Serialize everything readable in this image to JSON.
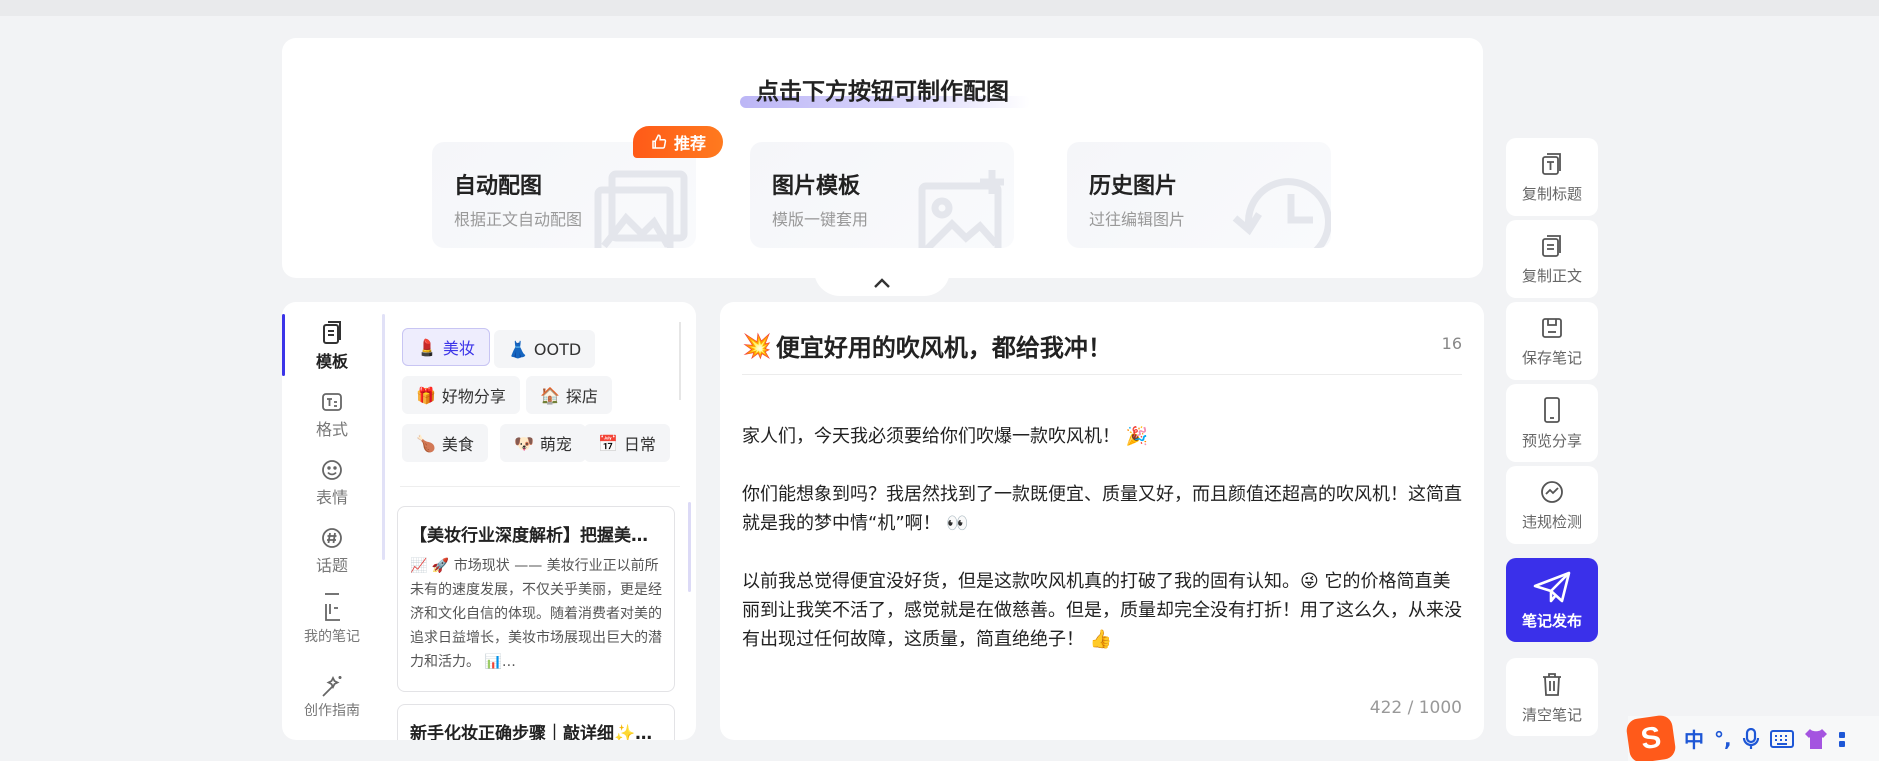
{
  "top_panel": {
    "title": "点击下方按钮可制作配图",
    "badge": "推荐",
    "cards": [
      {
        "name": "自动配图",
        "desc": "根据正文自动配图"
      },
      {
        "name": "图片模板",
        "desc": "模版一键套用"
      },
      {
        "name": "历史图片",
        "desc": "过往编辑图片"
      }
    ]
  },
  "side_nav": [
    {
      "label": "模板",
      "icon": "template-icon",
      "active": true
    },
    {
      "label": "格式",
      "icon": "format-icon"
    },
    {
      "label": "表情",
      "icon": "emoji-icon"
    },
    {
      "label": "话题",
      "icon": "hashtag-icon"
    },
    {
      "label": "我的笔记",
      "icon": "my-notes-icon"
    },
    {
      "label": "创作指南",
      "icon": "creation-guide-icon"
    }
  ],
  "categories": [
    {
      "emoji": "💄",
      "label": "美妆",
      "active": true
    },
    {
      "emoji": "👗",
      "label": "OOTD"
    },
    {
      "emoji": "🎁",
      "label": "好物分享"
    },
    {
      "emoji": "🏠",
      "label": "探店"
    },
    {
      "emoji": "🍗",
      "label": "美食"
    },
    {
      "emoji": "🐶",
      "label": "萌宠"
    },
    {
      "emoji": "📅",
      "label": "日常"
    }
  ],
  "template_cards": [
    {
      "title": "【美妆行业深度解析】把握美…",
      "body": "📈 🚀 市场现状 —— 美妆行业正以前所未有的速度发展，不仅关乎美丽，更是经济和文化自信的体现。随着消费者对美的追求日益增长，美妆市场展现出巨大的潜力和活力。 📊…"
    },
    {
      "title": "新手化妆正确步骤｜敲详细✨…",
      "body": ""
    }
  ],
  "editor": {
    "title_emoji": "💥",
    "title": "便宜好用的吹风机，都给我冲！",
    "title_count": "16",
    "paragraphs": [
      "家人们，今天我必须要给你们吹爆一款吹风机！ 🎉",
      "你们能想象到吗？我居然找到了一款既便宜、质量又好，而且颜值还超高的吹风机！这简直就是我的梦中情“机”啊！ 👀",
      "以前我总觉得便宜没好货，但是这款吹风机真的打破了我的固有认知。😜 它的价格简直美丽到让我笑不活了，感觉就是在做慈善。但是，质量却完全没有打折！用了这么久，从来没有出现过任何故障，这质量，简直绝绝子！ 👍"
    ],
    "char_count": "422 / 1000"
  },
  "toolbar": [
    {
      "label": "复制标题",
      "icon": "copy-title-icon"
    },
    {
      "label": "复制正文",
      "icon": "copy-body-icon"
    },
    {
      "label": "保存笔记",
      "icon": "save-icon"
    },
    {
      "label": "预览分享",
      "icon": "phone-preview-icon"
    },
    {
      "label": "违规检测",
      "icon": "violation-check-icon"
    },
    {
      "label": "笔记发布",
      "icon": "send-icon",
      "primary": true
    },
    {
      "label": "清空笔记",
      "icon": "trash-icon"
    }
  ],
  "ime": {
    "logo": "S",
    "lang": "中",
    "punct": "°,"
  },
  "colors": {
    "accent": "#3a30ea",
    "badge": "#ff5a18",
    "background": "#f2f3f5"
  }
}
